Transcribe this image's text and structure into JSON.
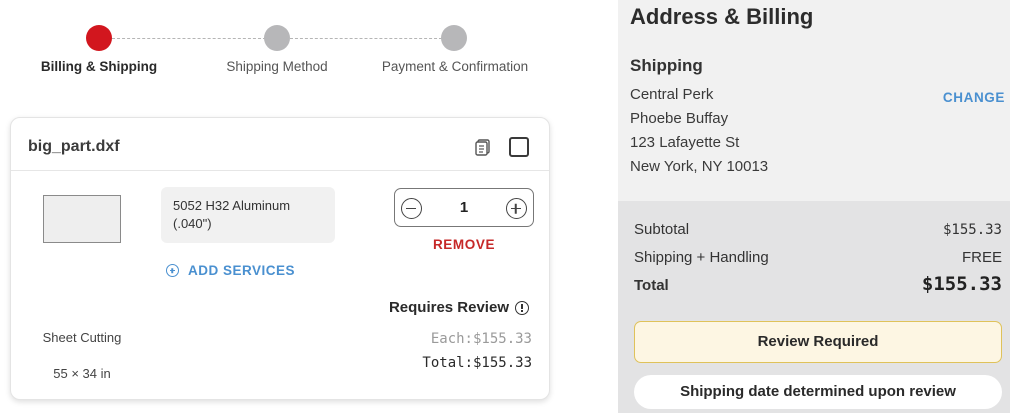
{
  "steps": [
    {
      "label": "Billing & Shipping",
      "active": true
    },
    {
      "label": "Shipping Method",
      "active": false
    },
    {
      "label": "Payment & Confirmation",
      "active": false
    }
  ],
  "part": {
    "file_name": "big_part.dxf",
    "material": "5052 H32 Aluminum (.040\")",
    "quantity": "1",
    "remove_label": "REMOVE",
    "add_services_label": "ADD SERVICES",
    "review_label": "Requires Review",
    "process": "Sheet Cutting",
    "dimensions": "55 × 34 in",
    "each_price": "Each:$155.33",
    "total_price": "Total:$155.33"
  },
  "sidebar": {
    "title": "Address & Billing",
    "shipping_heading": "Shipping",
    "change_label": "CHANGE",
    "address_lines": [
      "Central Perk",
      "Phoebe Buffay",
      "123 Lafayette St",
      "New York, NY 10013"
    ],
    "subtotal_label": "Subtotal",
    "subtotal_value": "$155.33",
    "shipping_label": "Shipping + Handling",
    "shipping_value": "FREE",
    "total_label": "Total",
    "total_value": "$155.33",
    "review_button_label": "Review Required",
    "ship_date_label": "Shipping date determined upon review"
  },
  "colors": {
    "active_step": "#d2161e",
    "inactive_step": "#b7b7b9",
    "link_blue": "#4a90d0",
    "remove_red": "#c62828",
    "review_bg": "#fdf6e3",
    "review_border": "#dfc25a"
  }
}
